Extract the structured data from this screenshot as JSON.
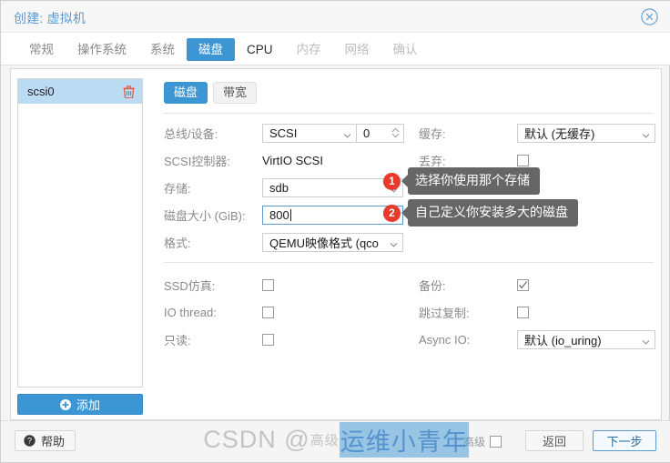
{
  "window": {
    "title": "创建: 虚拟机",
    "close_icon": "close-circle-icon"
  },
  "tabs": [
    {
      "label": "常规",
      "state": "inactive"
    },
    {
      "label": "操作系统",
      "state": "inactive"
    },
    {
      "label": "系统",
      "state": "inactive"
    },
    {
      "label": "磁盘",
      "state": "active"
    },
    {
      "label": "CPU",
      "state": "current"
    },
    {
      "label": "内存",
      "state": "disabled"
    },
    {
      "label": "网络",
      "state": "disabled"
    },
    {
      "label": "确认",
      "state": "disabled"
    }
  ],
  "device_list": {
    "items": [
      {
        "name": "scsi0",
        "delete_icon": "trash-icon"
      }
    ],
    "add_button": {
      "label": "添加",
      "icon": "plus-circle-icon"
    }
  },
  "subtabs": [
    {
      "label": "磁盘",
      "state": "active"
    },
    {
      "label": "带宽",
      "state": "idle"
    }
  ],
  "form": {
    "bus_device": {
      "label": "总线/设备:",
      "select_value": "SCSI",
      "number_value": "0"
    },
    "scsi_controller": {
      "label": "SCSI控制器:",
      "value": "VirtIO SCSI"
    },
    "storage": {
      "label": "存储:",
      "value": "sdb"
    },
    "disk_size": {
      "label": "磁盘大小 (GiB):",
      "value": "800"
    },
    "format": {
      "label": "格式:",
      "value": "QEMU映像格式 (qco"
    },
    "cache": {
      "label": "缓存:",
      "value": "默认 (无缓存)"
    },
    "discard": {
      "label": "丢弃:",
      "checked": false
    },
    "ssd_emulation": {
      "label": "SSD仿真:",
      "checked": false
    },
    "io_thread": {
      "label": "IO thread:",
      "checked": false
    },
    "readonly": {
      "label": "只读:",
      "checked": false
    },
    "backup": {
      "label": "备份:",
      "checked": true
    },
    "skip_replication": {
      "label": "跳过复制:",
      "checked": false
    },
    "async_io": {
      "label": "Async IO:",
      "value": "默认 (io_uring)"
    }
  },
  "callouts": [
    {
      "number": "1",
      "text": "选择你使用那个存储"
    },
    {
      "number": "2",
      "text": "自己定义你安装多大的磁盘"
    }
  ],
  "footer": {
    "help_label": "帮助",
    "help_icon": "question-circle-icon",
    "advanced_label": "高级",
    "advanced_checked": false,
    "back_label": "返回",
    "next_label": "下一步"
  },
  "watermark": {
    "prefix": "CSDN @",
    "small": "高级",
    "highlight": "运维小青年"
  },
  "colors": {
    "accent": "#3c96d4",
    "title": "#5b9bd5",
    "badge": "#e8392b",
    "tooltip": "#666666",
    "selection": "#bcdcf4"
  }
}
